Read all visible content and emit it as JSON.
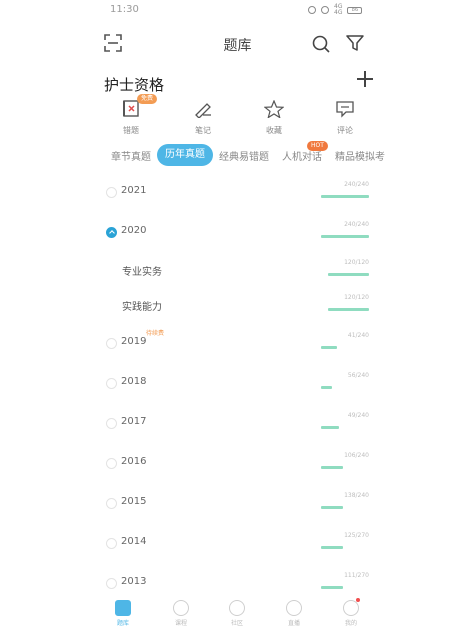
{
  "status_bar": {
    "time": "11:30",
    "signal_text": "4G",
    "signal_text2": "4G",
    "battery": "86"
  },
  "header": {
    "title": "题库"
  },
  "section": {
    "title": "护士资格"
  },
  "quick_actions": [
    {
      "label": "错题",
      "icon": "wrong-book-icon",
      "badge": "免费"
    },
    {
      "label": "笔记",
      "icon": "note-icon",
      "badge": ""
    },
    {
      "label": "收藏",
      "icon": "star-icon",
      "badge": ""
    },
    {
      "label": "评论",
      "icon": "comment-icon",
      "badge": ""
    }
  ],
  "tabs": [
    {
      "label": "章节真题",
      "active": false,
      "badge": ""
    },
    {
      "label": "历年真题",
      "active": true,
      "badge": ""
    },
    {
      "label": "经典易错题",
      "active": false,
      "badge": ""
    },
    {
      "label": "人机对话",
      "active": false,
      "badge": "HOT"
    },
    {
      "label": "精品模拟考",
      "active": false,
      "badge": ""
    }
  ],
  "years": [
    {
      "year": "2021",
      "expanded": false,
      "score": "240/240",
      "progress": 1.0,
      "tag": ""
    },
    {
      "year": "2020",
      "expanded": true,
      "score": "240/240",
      "progress": 1.0,
      "tag": "",
      "children": [
        {
          "label": "专业实务",
          "score": "120/120",
          "progress": 1.0
        },
        {
          "label": "实践能力",
          "score": "120/120",
          "progress": 1.0
        }
      ]
    },
    {
      "year": "2019",
      "expanded": false,
      "score": "41/240",
      "progress": 0.33,
      "tag": "待续费"
    },
    {
      "year": "2018",
      "expanded": false,
      "score": "56/240",
      "progress": 0.23,
      "tag": ""
    },
    {
      "year": "2017",
      "expanded": false,
      "score": "49/240",
      "progress": 0.38,
      "tag": ""
    },
    {
      "year": "2016",
      "expanded": false,
      "score": "106/240",
      "progress": 0.46,
      "tag": ""
    },
    {
      "year": "2015",
      "expanded": false,
      "score": "138/240",
      "progress": 0.46,
      "tag": ""
    },
    {
      "year": "2014",
      "expanded": false,
      "score": "125/270",
      "progress": 0.46,
      "tag": ""
    },
    {
      "year": "2013",
      "expanded": false,
      "score": "111/270",
      "progress": 0.46,
      "tag": ""
    }
  ],
  "bottom_nav": [
    {
      "label": "题库",
      "active": true
    },
    {
      "label": "课程",
      "active": false
    },
    {
      "label": "社区",
      "active": false
    },
    {
      "label": "直播",
      "active": false
    },
    {
      "label": "我的",
      "active": false
    }
  ]
}
